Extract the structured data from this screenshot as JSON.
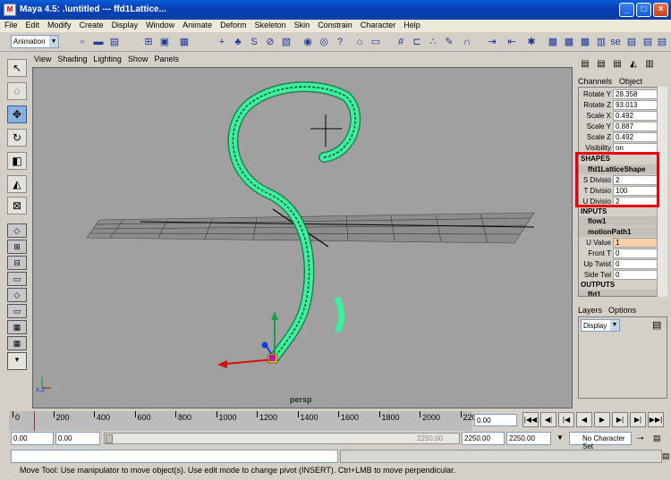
{
  "window": {
    "title": "Maya 4.5: .\\untitled   ---   ffd1Lattice...",
    "min": "_",
    "max": "□",
    "close": "×"
  },
  "menu": [
    "File",
    "Edit",
    "Modify",
    "Create",
    "Display",
    "Window",
    "Animate",
    "Deform",
    "Skeleton",
    "Skin",
    "Constrain",
    "Character",
    "Help"
  ],
  "shelf": {
    "mode": "Animation"
  },
  "panel_menu": [
    "View",
    "Shading",
    "Lighting",
    "Show",
    "Panels"
  ],
  "viewport": {
    "camera": "persp",
    "axis_label": "x,z"
  },
  "channel_box": {
    "tabs": [
      "Channels",
      "Object"
    ],
    "attributes": [
      {
        "label": "Rotate Y",
        "value": "28.358"
      },
      {
        "label": "Rotate Z",
        "value": "93.013"
      },
      {
        "label": "Scale X",
        "value": "0.492"
      },
      {
        "label": "Scale Y",
        "value": "0.887"
      },
      {
        "label": "Scale Z",
        "value": "0.492"
      },
      {
        "label": "Visibility",
        "value": "on"
      }
    ],
    "shapes_header": "SHAPES",
    "shape_node": "ffd1LatticeShape",
    "shape_attrs": [
      {
        "label": "S Divisio",
        "value": "2"
      },
      {
        "label": "T Divisio",
        "value": "100"
      },
      {
        "label": "U Divisio",
        "value": "2"
      }
    ],
    "inputs_header": "INPUTS",
    "input_node1": "flow1",
    "input_node2": "motionPath1",
    "input_attrs": [
      {
        "label": "U Value",
        "value": "1"
      },
      {
        "label": "Front T",
        "value": "0"
      },
      {
        "label": "Up Twist",
        "value": "0"
      },
      {
        "label": "Side Twi",
        "value": "0"
      }
    ],
    "outputs_header": "OUTPUTS",
    "output_node": "ffd1"
  },
  "layers": {
    "tabs": [
      "Layers",
      "Options"
    ],
    "display": "Display"
  },
  "timeline": {
    "ticks": [
      "0",
      "200",
      "400",
      "600",
      "800",
      "1000",
      "1200",
      "1400",
      "1600",
      "1800",
      "2000",
      "220"
    ],
    "current_frame": "0.00"
  },
  "range": {
    "start": "0.00",
    "anim_start": "0.00",
    "slider_end_readout": "2250.00",
    "playback_end": "2250.00",
    "anim_end": "2250.00",
    "character_set": "No Character Set"
  },
  "help_line": "Move Tool: Use manipulator to move object(s). Use edit mode to change pivot (INSERT).  Ctrl+LMB to move perpendicular.",
  "colors": {
    "highlight_box": "#e8000a",
    "lattice": "#3cf0a0",
    "viewport_bg": "#a0a0a0"
  }
}
